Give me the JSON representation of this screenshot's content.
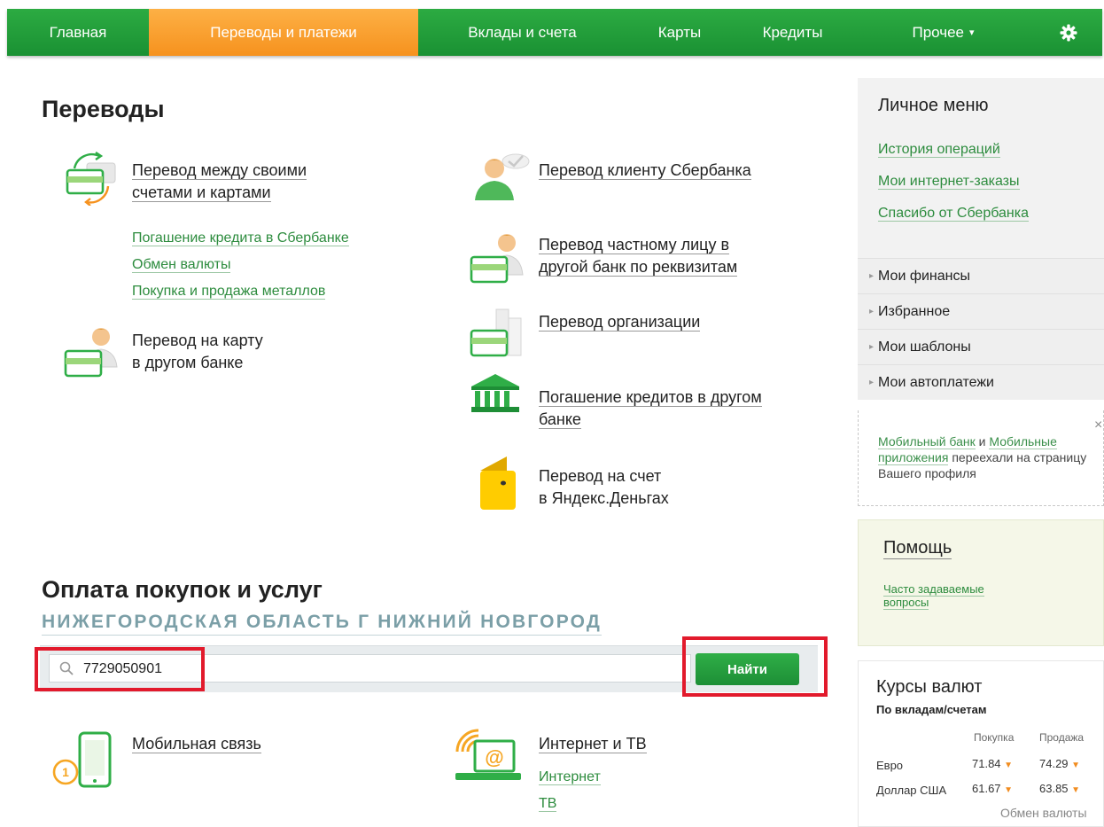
{
  "nav": {
    "tabs": [
      {
        "label": "Главная"
      },
      {
        "label": "Переводы и платежи"
      },
      {
        "label": "Вклады и счета"
      },
      {
        "label": "Карты"
      },
      {
        "label": "Кредиты"
      },
      {
        "label": "Прочее"
      }
    ],
    "more_caret": "▾",
    "settings_icon": "gear-icon"
  },
  "transfers": {
    "title": "Переводы",
    "own_accounts": {
      "line1": "Перевод между своими",
      "line2": "счетами и картами"
    },
    "sublinks": [
      "Погашение кредита в Сбербанке",
      "Обмен валюты",
      "Покупка и продажа металлов"
    ],
    "card_other_bank": {
      "line1": "Перевод на карту",
      "line2": "в другом банке"
    },
    "sber_client": "Перевод клиенту Сбербанка",
    "private_person": {
      "line1": "Перевод частному лицу в",
      "line2": "другой банк по реквизитам"
    },
    "organization": "Перевод организации",
    "other_bank_credit": {
      "line1": "Погашение кредитов в другом",
      "line2": "банке"
    },
    "yandex": {
      "line1": "Перевод на счет",
      "line2": "в Яндекс.Деньгах"
    }
  },
  "payments": {
    "title": "Оплата покупок и услуг",
    "region": "НИЖЕГОРОДСКАЯ ОБЛАСТЬ Г НИЖНИЙ НОВГОРОД",
    "search_value": "7729050901",
    "find_label": "Найти",
    "mobile": {
      "label": "Мобильная связь",
      "badge": "1"
    },
    "internet_tv": {
      "label": "Интернет и ТВ",
      "sub": [
        "Интернет",
        "ТВ"
      ]
    }
  },
  "personal_menu": {
    "title": "Личное меню",
    "links": [
      "История операций",
      "Мои интернет-заказы",
      "Спасибо от Сбербанка"
    ],
    "rows": [
      "Мои финансы",
      "Избранное",
      "Мои шаблоны",
      "Мои автоплатежи"
    ]
  },
  "notice": {
    "link1": "Мобильный банк",
    "and": " и ",
    "link2": "Мобильные приложения",
    "rest": " переехали на страницу Вашего профиля",
    "close": "×"
  },
  "help": {
    "title": "Помощь",
    "faq_line1": "Часто задаваемые",
    "faq_line2": "вопросы"
  },
  "rates": {
    "title": "Курсы валют",
    "subtitle": "По вкладам/счетам",
    "buy_header": "Покупка",
    "sell_header": "Продажа",
    "rows": [
      {
        "currency": "Евро",
        "buy": "71.84",
        "sell": "74.29"
      },
      {
        "currency": "Доллар США",
        "buy": "61.67",
        "sell": "63.85"
      }
    ],
    "exchange_link": "Обмен валюты",
    "trend_color": "#f18c1f"
  },
  "colors": {
    "brand_green": "#21a038",
    "active_tab": "#f6921e",
    "link_green": "#2d8c3e",
    "highlight_red": "#e21a2c"
  }
}
